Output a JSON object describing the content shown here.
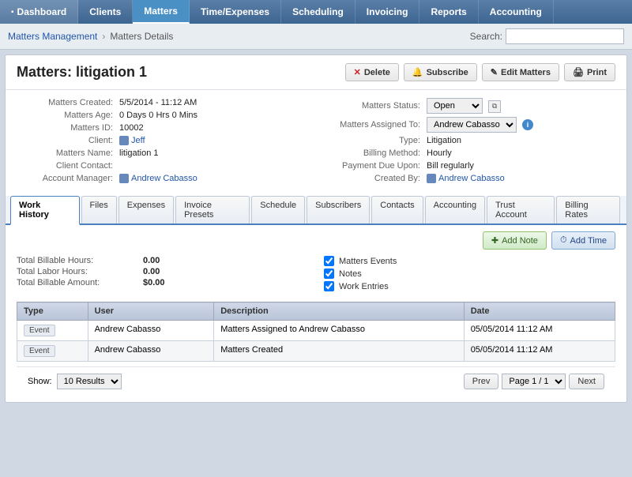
{
  "nav": {
    "items": [
      {
        "label": "Dashboard",
        "active": false
      },
      {
        "label": "Clients",
        "active": false
      },
      {
        "label": "Matters",
        "active": true
      },
      {
        "label": "Time/Expenses",
        "active": false
      },
      {
        "label": "Scheduling",
        "active": false
      },
      {
        "label": "Invoicing",
        "active": false
      },
      {
        "label": "Reports",
        "active": false
      },
      {
        "label": "Accounting",
        "active": false
      }
    ]
  },
  "breadcrumb": {
    "parent": "Matters Management",
    "current": "Matters Details"
  },
  "search": {
    "label": "Search:",
    "placeholder": ""
  },
  "matter": {
    "title": "Matters: litigation 1",
    "buttons": {
      "delete": "Delete",
      "subscribe": "Subscribe",
      "edit": "Edit Matters",
      "print": "Print"
    },
    "fields_left": {
      "created_label": "Matters Created:",
      "created_value": "5/5/2014 - 11:12 AM",
      "age_label": "Matters Age:",
      "age_value": "0 Days 0 Hrs 0 Mins",
      "id_label": "Matters ID:",
      "id_value": "10002",
      "client_label": "Client:",
      "client_value": "Jeff",
      "name_label": "Matters Name:",
      "name_value": "litigation 1",
      "contact_label": "Client Contact:",
      "contact_value": "",
      "manager_label": "Account Manager:",
      "manager_value": "Andrew Cabasso"
    },
    "fields_right": {
      "status_label": "Matters Status:",
      "status_value": "Open",
      "assigned_label": "Matters Assigned To:",
      "assigned_value": "Andrew Cabasso",
      "type_label": "Type:",
      "type_value": "Litigation",
      "billing_label": "Billing Method:",
      "billing_value": "Hourly",
      "payment_label": "Payment Due Upon:",
      "payment_value": "Bill regularly",
      "created_by_label": "Created By:",
      "created_by_value": "Andrew Cabasso"
    }
  },
  "tabs": [
    {
      "label": "Work History",
      "active": true
    },
    {
      "label": "Files",
      "active": false
    },
    {
      "label": "Expenses",
      "active": false
    },
    {
      "label": "Invoice Presets",
      "active": false
    },
    {
      "label": "Schedule",
      "active": false
    },
    {
      "label": "Subscribers",
      "active": false
    },
    {
      "label": "Contacts",
      "active": false
    },
    {
      "label": "Accounting",
      "active": false
    },
    {
      "label": "Trust Account",
      "active": false
    },
    {
      "label": "Billing Rates",
      "active": false
    }
  ],
  "work_area": {
    "add_note_btn": "Add Note",
    "add_time_btn": "Add Time",
    "totals": {
      "billable_hours_label": "Total Billable Hours:",
      "billable_hours_value": "0.00",
      "labor_hours_label": "Total Labor Hours:",
      "labor_hours_value": "0.00",
      "billable_amount_label": "Total Billable Amount:",
      "billable_amount_value": "$0.00"
    },
    "checkboxes": {
      "matters_events": "Matters Events",
      "notes": "Notes",
      "work_entries": "Work Entries"
    },
    "table": {
      "columns": [
        "Type",
        "User",
        "Description",
        "Date"
      ],
      "rows": [
        {
          "type": "Event",
          "user": "Andrew Cabasso",
          "description": "Matters Assigned to Andrew Cabasso",
          "date": "05/05/2014 11:12 AM"
        },
        {
          "type": "Event",
          "user": "Andrew Cabasso",
          "description": "Matters Created",
          "date": "05/05/2014 11:12 AM"
        }
      ]
    },
    "pagination": {
      "show_label": "Show:",
      "show_value": "10 Results",
      "prev_btn": "Prev",
      "page_label": "Page 1 / 1",
      "next_btn": "Next"
    }
  }
}
